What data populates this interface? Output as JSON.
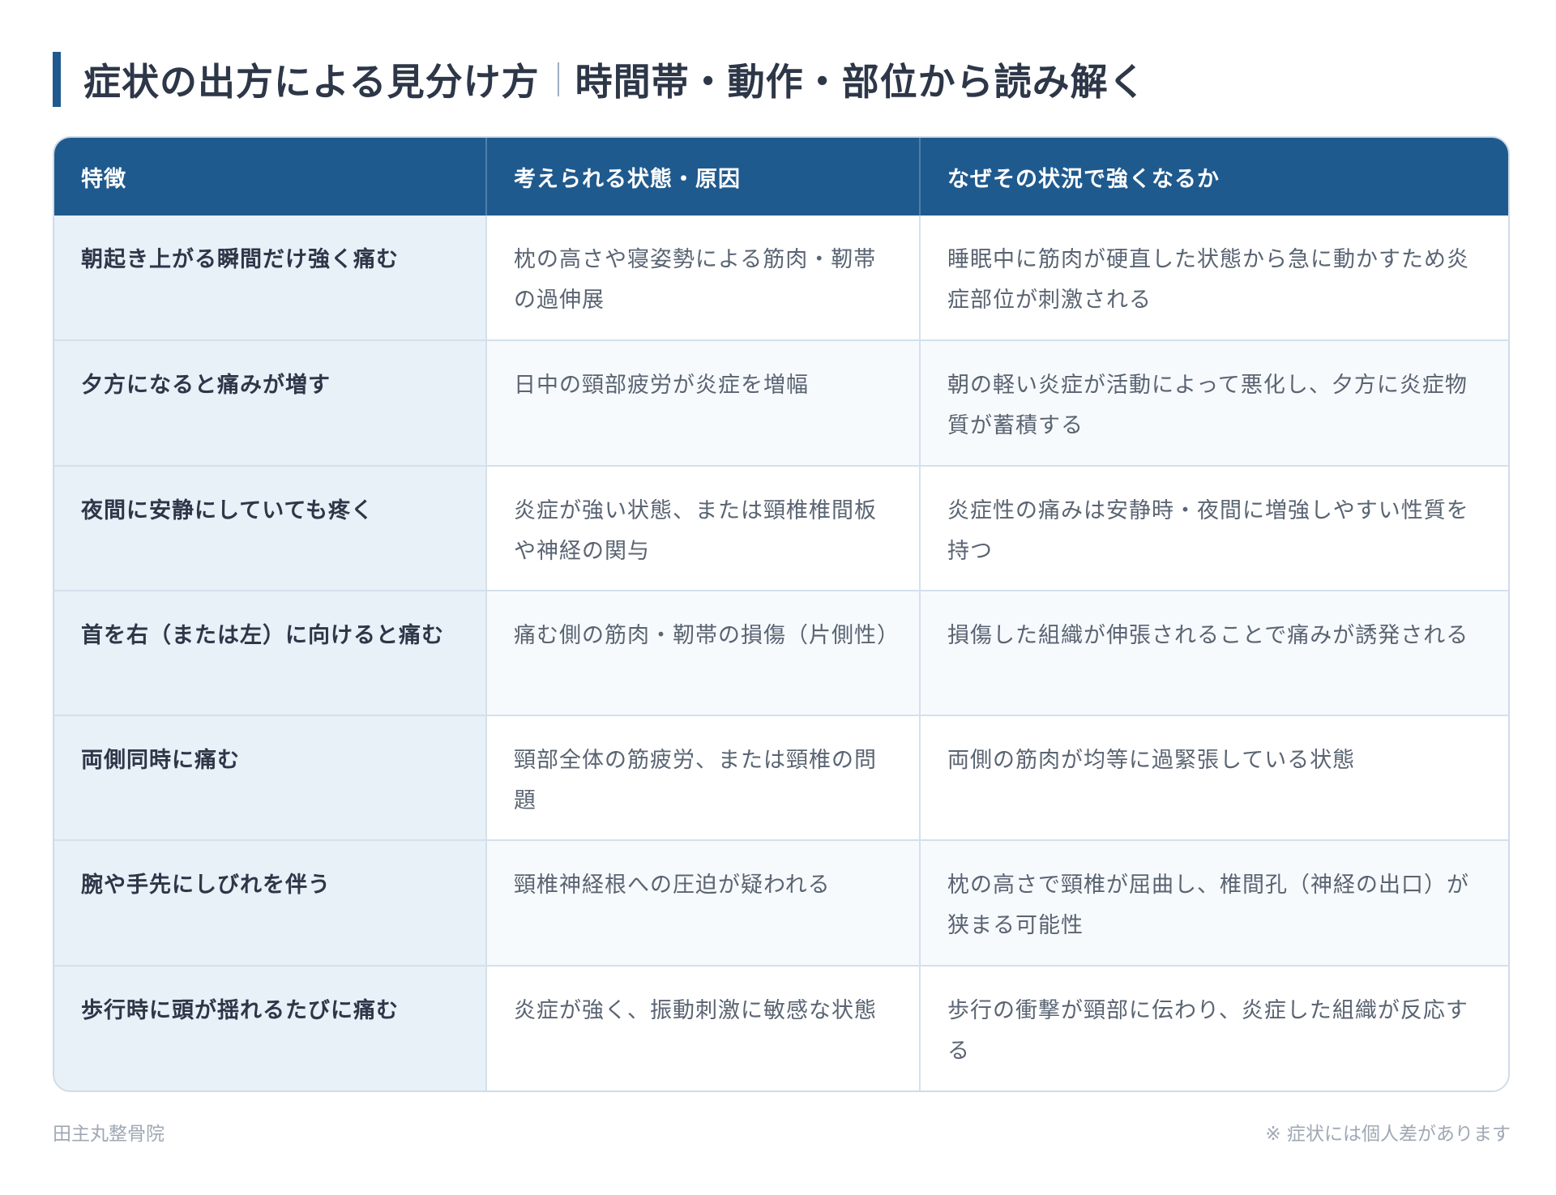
{
  "title": {
    "main": "症状の出方による見分け方",
    "sub": "時間帯・動作・部位から読み解く"
  },
  "table": {
    "headers": [
      "特徴",
      "考えられる状態・原因",
      "なぜその状況で強くなるか"
    ],
    "rows": [
      {
        "feature": "朝起き上がる瞬間だけ強く痛む",
        "cause": "枕の高さや寝姿勢による筋肉・靭帯の過伸展",
        "reason": "睡眠中に筋肉が硬直した状態から急に動かすため炎症部位が刺激される"
      },
      {
        "feature": "夕方になると痛みが増す",
        "cause": "日中の頸部疲労が炎症を増幅",
        "reason": "朝の軽い炎症が活動によって悪化し、夕方に炎症物質が蓄積する"
      },
      {
        "feature": "夜間に安静にしていても疼く",
        "cause": "炎症が強い状態、または頸椎椎間板や神経の関与",
        "reason": "炎症性の痛みは安静時・夜間に増強しやすい性質を持つ"
      },
      {
        "feature": "首を右（または左）に向けると痛む",
        "cause": "痛む側の筋肉・靭帯の損傷（片側性）",
        "reason": "損傷した組織が伸張されることで痛みが誘発される"
      },
      {
        "feature": "両側同時に痛む",
        "cause": "頸部全体の筋疲労、または頸椎の問題",
        "reason": "両側の筋肉が均等に過緊張している状態"
      },
      {
        "feature": "腕や手先にしびれを伴う",
        "cause": "頸椎神経根への圧迫が疑われる",
        "reason": "枕の高さで頸椎が屈曲し、椎間孔（神経の出口）が狭まる可能性"
      },
      {
        "feature": "歩行時に頭が揺れるたびに痛む",
        "cause": "炎症が強く、振動刺激に敏感な状態",
        "reason": "歩行の衝撃が頸部に伝わり、炎症した組織が反応する"
      }
    ]
  },
  "footer": {
    "clinic": "田主丸整骨院",
    "note": "※ 症状には個人差があります"
  },
  "colors": {
    "header_bg": "#1f5a8e",
    "accent_bar": "#1f5a8e",
    "feature_bg": "#e8f0f8"
  }
}
